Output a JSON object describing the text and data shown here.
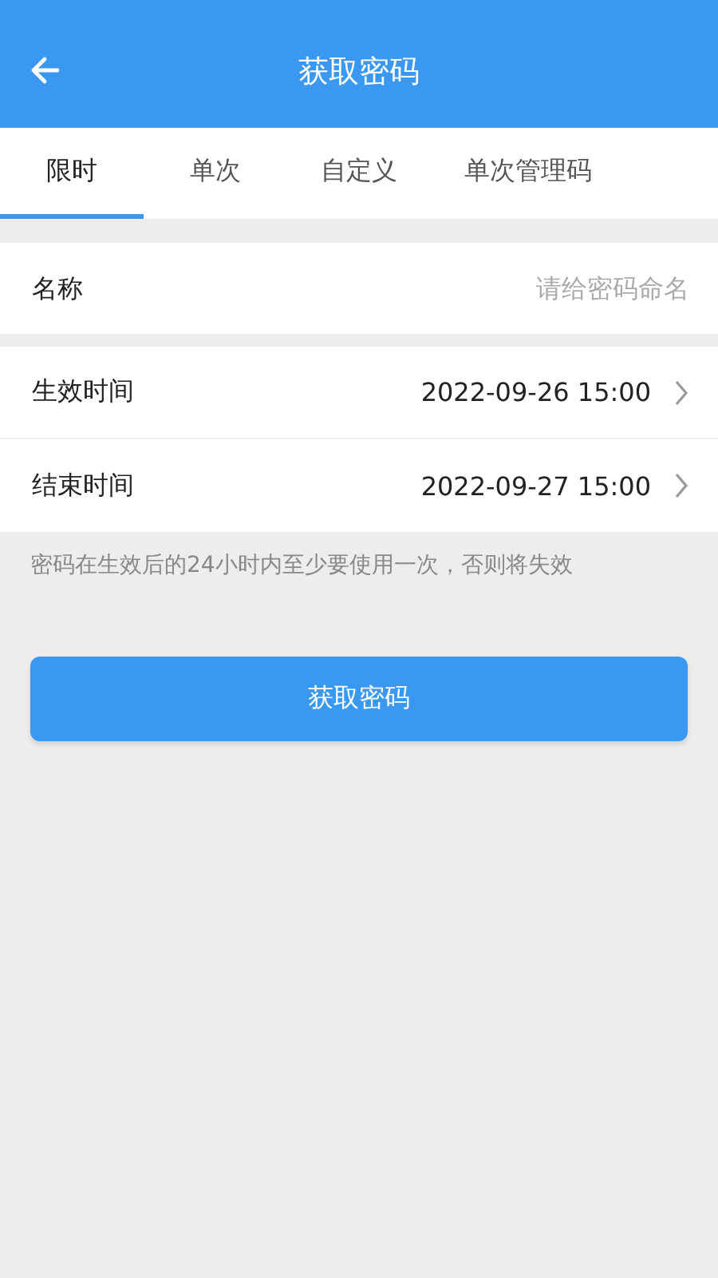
{
  "header": {
    "title": "获取密码"
  },
  "tabs": [
    {
      "label": "限时",
      "selected": true
    },
    {
      "label": "单次",
      "selected": false
    },
    {
      "label": "自定义",
      "selected": false
    },
    {
      "label": "单次管理码",
      "selected": false
    }
  ],
  "name_field": {
    "label": "名称",
    "placeholder": "请给密码命名"
  },
  "time_rows": [
    {
      "label": "生效时间",
      "value": "2022-09-26 15:00"
    },
    {
      "label": "结束时间",
      "value": "2022-09-27 15:00"
    }
  ],
  "note": "密码在生效后的24小时内至少要使用一次，否则将失效",
  "submit_button": "获取密码"
}
